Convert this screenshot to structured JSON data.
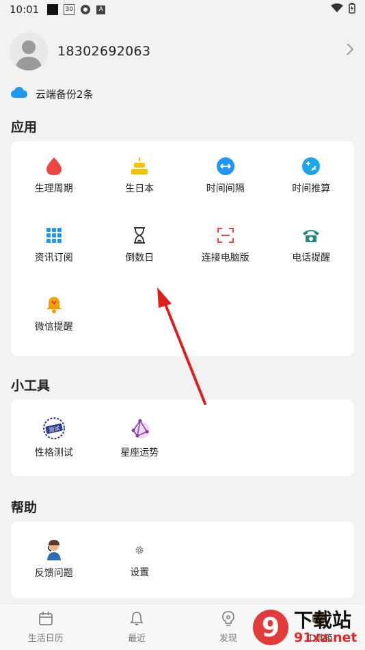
{
  "status_bar": {
    "time": "10:01",
    "calendar_badge": "30",
    "a_badge": "A"
  },
  "profile": {
    "phone": "18302692063"
  },
  "cloud": {
    "label": "云端备份2条"
  },
  "sections": {
    "apps": {
      "title": "应用",
      "items": [
        {
          "label": "生理周期",
          "icon": "drop-icon"
        },
        {
          "label": "生日本",
          "icon": "cake-icon"
        },
        {
          "label": "时间间隔",
          "icon": "interval-icon"
        },
        {
          "label": "时间推算",
          "icon": "calc-icon"
        },
        {
          "label": "资讯订阅",
          "icon": "grid-icon"
        },
        {
          "label": "倒数日",
          "icon": "hourglass-icon"
        },
        {
          "label": "连接电脑版",
          "icon": "scan-icon"
        },
        {
          "label": "电话提醒",
          "icon": "phone-icon"
        },
        {
          "label": "微信提醒",
          "icon": "bell-icon"
        }
      ]
    },
    "tools": {
      "title": "小工具",
      "items": [
        {
          "label": "性格测试",
          "icon": "test-stamp-icon",
          "stamp_text": "测试"
        },
        {
          "label": "星座运势",
          "icon": "constellation-icon"
        }
      ]
    },
    "help": {
      "title": "帮助",
      "items": [
        {
          "label": "反馈问题",
          "icon": "support-agent-icon"
        },
        {
          "label": "设置",
          "icon": "gear-icon"
        }
      ]
    }
  },
  "bottom_nav": [
    {
      "label": "生活日历",
      "icon": "calendar-icon"
    },
    {
      "label": "最近",
      "icon": "bell-outline-icon"
    },
    {
      "label": "发现",
      "icon": "bulb-icon"
    },
    {
      "label": "工具箱",
      "icon": "box-icon"
    }
  ],
  "watermark": {
    "top": "下载站",
    "bottom": "91xz.net",
    "logo": "9"
  },
  "colors": {
    "blue": "#2196f3",
    "red": "#ef4444",
    "yellow": "#f5c400",
    "green": "#1f8a7a",
    "orange": "#f59e0b",
    "arrow": "#e01e1e"
  }
}
